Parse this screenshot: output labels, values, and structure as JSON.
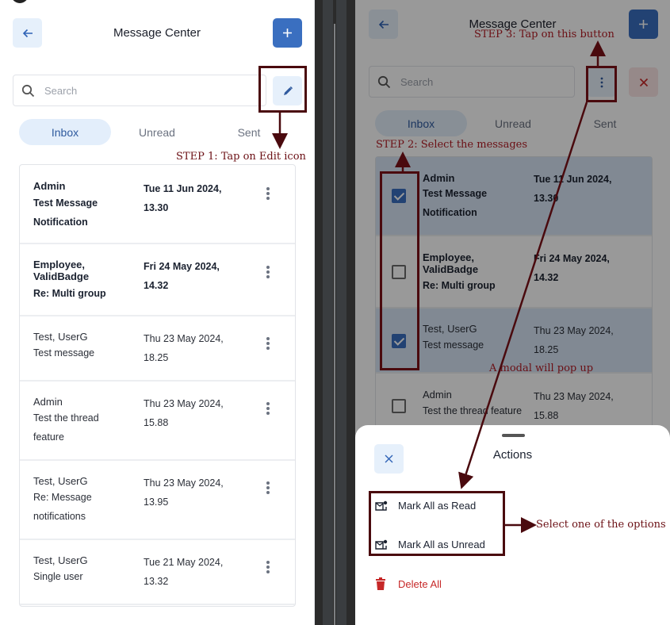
{
  "header": {
    "title": "Message Center",
    "back_icon": "arrow-left-icon",
    "add_icon": "plus-icon"
  },
  "search": {
    "placeholder": "Search",
    "value": "",
    "icon": "search-icon"
  },
  "edit_icon": "pencil-icon",
  "more_icon": "kebab-vertical-icon",
  "cancel_icon": "close-icon",
  "tabs": [
    {
      "label": "Inbox",
      "active": true
    },
    {
      "label": "Unread",
      "active": false
    },
    {
      "label": "Sent",
      "active": false
    }
  ],
  "messages": [
    {
      "from": "Admin",
      "subject_lines": [
        "Test Message",
        "Notification"
      ],
      "date_lines": [
        "Tue 11 Jun 2024,",
        "13.30"
      ],
      "unread": true
    },
    {
      "from_lines": [
        "Employee,",
        "ValidBadge"
      ],
      "subject_lines": [
        "Re: Multi group"
      ],
      "date_lines": [
        "Fri 24 May 2024,",
        "14.32"
      ],
      "unread": true
    },
    {
      "from": "Test, UserG",
      "subject_lines": [
        "Test message"
      ],
      "date_lines": [
        "Thu 23 May 2024,",
        "18.25"
      ],
      "unread": false
    },
    {
      "from": "Admin",
      "subject_lines": [
        "Test the thread",
        "feature"
      ],
      "date_lines": [
        "Thu 23 May 2024,",
        "15.88"
      ],
      "unread": false
    },
    {
      "from": "Test, UserG",
      "subject_lines": [
        "Re: Message",
        "notifications"
      ],
      "date_lines": [
        "Thu 23 May 2024,",
        "13.95"
      ],
      "unread": false
    },
    {
      "from": "Test, UserG",
      "subject_lines": [
        "Single user"
      ],
      "date_lines": [
        "Tue 21 May 2024,",
        "13.32"
      ],
      "unread": false
    }
  ],
  "selection": {
    "selected": [
      true,
      false,
      true,
      false
    ],
    "right_messages_subject_4": "Test the thread feature"
  },
  "action_sheet": {
    "title": "Actions",
    "close_icon": "close-icon",
    "actions": [
      {
        "label": "Mark All as Read",
        "icon": "mail-mark-icon"
      },
      {
        "label": "Mark All as Unread",
        "icon": "mail-mark-icon"
      },
      {
        "label": "Delete All",
        "icon": "trash-icon",
        "danger": true
      }
    ]
  },
  "annotations": {
    "step1": "STEP 1: Tap on Edit icon",
    "step2": "STEP 2: Select the messages",
    "step3": "STEP 3: Tap on this button",
    "modal_note": "A modal will pop up",
    "select_note": "Select one of the options"
  },
  "colors": {
    "primary": "#3a6fc0",
    "light_button": "#e6f0fb",
    "danger": "#c62828",
    "annotation": "#6b0f14",
    "selected_row": "#d7e5f5"
  }
}
